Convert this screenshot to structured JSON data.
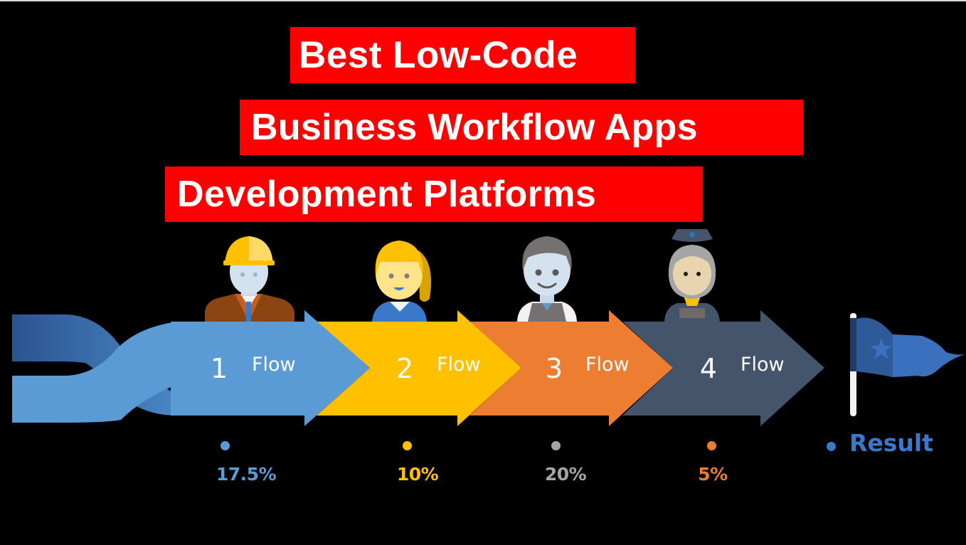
{
  "title": {
    "line1": "Best Low-Code",
    "line2": "Business Workflow Apps",
    "line3": "Development Platforms",
    "background_color": "#ff0000",
    "text_color": "#ffffff"
  },
  "steps": [
    {
      "number": "1",
      "label": "Flow",
      "color": "#5b9bd5",
      "character": "construction-worker-icon",
      "percent": "17.5%",
      "percent_color": "#5b9bd5"
    },
    {
      "number": "2",
      "label": "Flow",
      "color": "#ffc000",
      "character": "businesswoman-icon",
      "percent": "10%",
      "percent_color": "#ffc000"
    },
    {
      "number": "3",
      "label": "Flow",
      "color": "#ed7d31",
      "character": "waiter-icon",
      "percent": "20%",
      "percent_color": "#a5a5a5"
    },
    {
      "number": "4",
      "label": "Flow",
      "color": "#44546a",
      "character": "nurse-icon",
      "percent": "5%",
      "percent_color": "#ed7d31"
    }
  ],
  "result": {
    "label": "Result",
    "color": "#3a78c9",
    "icon": "flag-icon"
  }
}
